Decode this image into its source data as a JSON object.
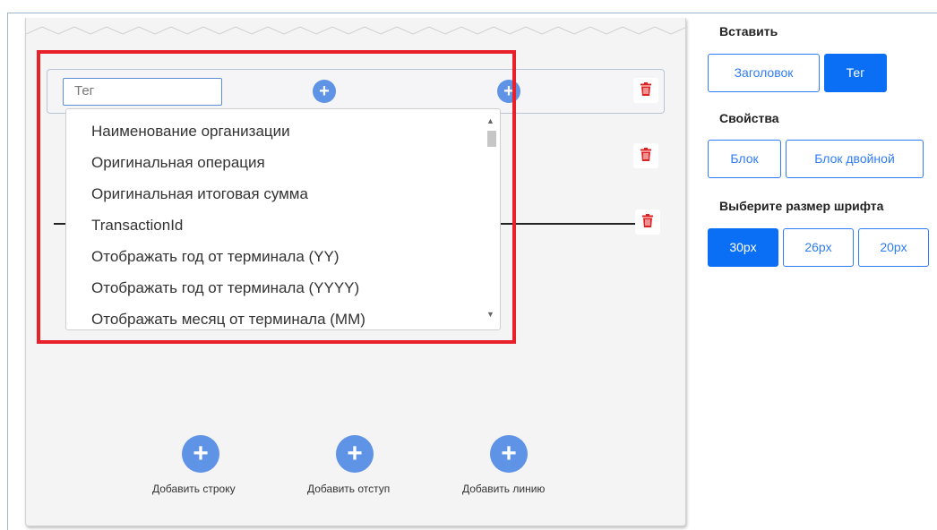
{
  "tag_field": {
    "placeholder": "Тег"
  },
  "dropdown": {
    "options": [
      "Наименование организации",
      "Оригинальная операция",
      "Оригинальная итоговая сумма",
      "TransactionId",
      "Отображать год от терминала (YY)",
      "Отображать год от терминала (YYYY)",
      "Отображать месяц от терминала (MM)"
    ]
  },
  "bottom_actions": {
    "add_row": "Добавить строку",
    "add_indent": "Добавить отступ",
    "add_line": "Добавить линию"
  },
  "panel": {
    "insert_title": "Вставить",
    "insert_options": {
      "heading": "Заголовок",
      "tag": "Тег"
    },
    "insert_selected": "Тег",
    "properties_title": "Свойства",
    "properties_options": {
      "block": "Блок",
      "double_block": "Блок двойной"
    },
    "font_size_title": "Выберите размер шрифта",
    "font_sizes": [
      "30px",
      "26px",
      "20px"
    ],
    "font_size_selected": "30px"
  },
  "colors": {
    "accent": "#0b6ff5",
    "add_button": "#5f93e6",
    "delete_icon": "#e02020",
    "highlight_box": "#e8202a"
  }
}
